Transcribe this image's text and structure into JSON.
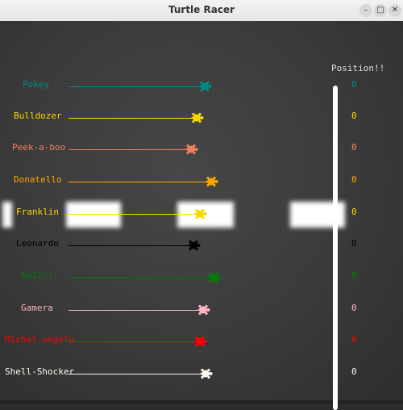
{
  "window": {
    "title": "Turtle Racer",
    "controls": {
      "minimize": "–",
      "maximize": "□",
      "close": "✕"
    }
  },
  "board": {
    "position_heading": "Position!!",
    "racers": [
      {
        "name": "Pokey",
        "color": "#008b8b",
        "position": "0"
      },
      {
        "name": "Bulldozer",
        "color": "#ffd700",
        "position": "0"
      },
      {
        "name": "Peek-a-boo",
        "color": "#f08060",
        "position": "0"
      },
      {
        "name": "Donatello",
        "color": "#ffa500",
        "position": "0"
      },
      {
        "name": "Franklin",
        "color": "#ffd700",
        "position": "0"
      },
      {
        "name": "Leonardo",
        "color": "#000000",
        "position": "0"
      },
      {
        "name": "Sp1ir!",
        "color": "#008000",
        "position": "0"
      },
      {
        "name": "Gamera",
        "color": "#ffb6c1",
        "position": "0"
      },
      {
        "name": "Michel-angelo",
        "color": "#ff0000",
        "position": "0"
      },
      {
        "name": "Shell-Shocker",
        "color": "#fffaf0",
        "position": "0"
      }
    ]
  }
}
